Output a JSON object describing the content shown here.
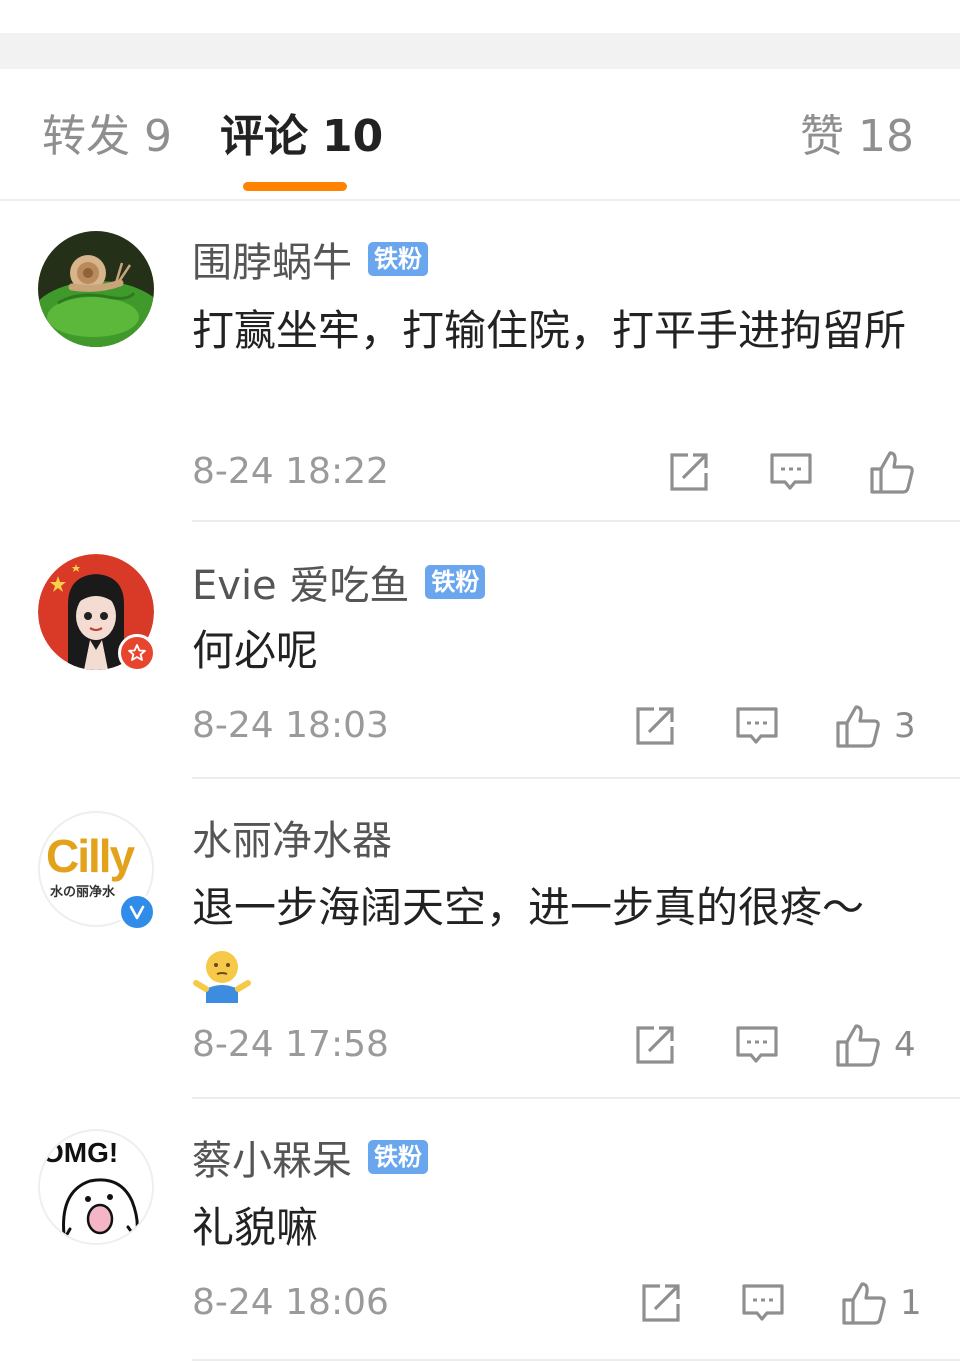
{
  "tabs": {
    "reposts": {
      "label": "转发",
      "count": "9"
    },
    "comments": {
      "label": "评论",
      "count": "10"
    },
    "likes": {
      "label": "赞",
      "count": "18"
    }
  },
  "colors": {
    "accent": "#ff8200",
    "fan_badge": "#6aa6ee",
    "verified": "#2f8de9",
    "star_badge": "#e8452e"
  },
  "comments": [
    {
      "username": "围脖蜗牛",
      "badge": "铁粉",
      "text": "打赢坐牢，打输住院，打平手进拘留所",
      "time": "8-24 18:22",
      "likes": "",
      "avatar_icon": "snail-avatar"
    },
    {
      "username": "Evie 爱吃鱼",
      "badge": "铁粉",
      "text": "何必呢",
      "time": "8-24 18:03",
      "likes": "3",
      "avatar_icon": "cartoon-girl-avatar"
    },
    {
      "username": "水丽净水器",
      "badge": "",
      "text": "退一步海阔天空，进一步真的很疼～",
      "emoji": "shrug-emoji",
      "time": "8-24 17:58",
      "likes": "4",
      "avatar_icon": "cilly-logo-avatar",
      "avatar_logo_text": "Cilly",
      "avatar_logo_subtext": "水の丽净水"
    },
    {
      "username": "蔡小槑呆",
      "badge": "铁粉",
      "text": "礼貌嘛",
      "time": "8-24 18:06",
      "likes": "1",
      "avatar_icon": "omg-cartoon-avatar",
      "avatar_logo_text": "OMG!"
    }
  ]
}
